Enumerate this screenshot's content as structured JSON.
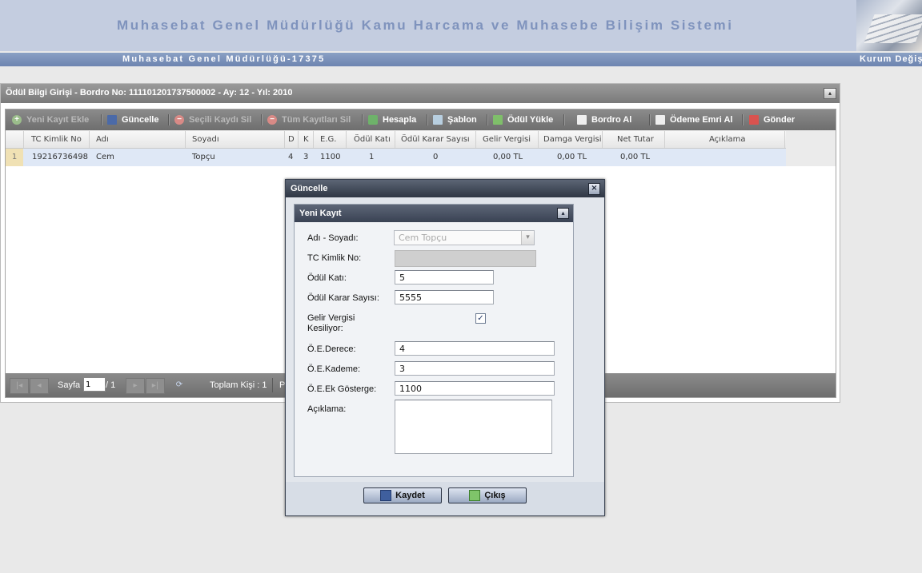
{
  "header": {
    "system_title": "Muhasebat Genel Müdürlüğü Kamu Harcama ve Muhasebe Bilişim Sistemi",
    "org_name": "Muhasebat Genel Müdürlüğü-17375",
    "kurum_link": "Kurum Değiş"
  },
  "panel": {
    "title": "Ödül Bilgi Girişi - Bordro No: 111101201737500002 - Ay: 12 - Yıl: 2010"
  },
  "toolbar": {
    "items": [
      {
        "label": "Yeni Kayıt Ekle",
        "icon": "add-icon",
        "enabled": false
      },
      {
        "label": "Güncelle",
        "icon": "save-icon",
        "enabled": true
      },
      {
        "label": "Seçili Kaydı Sil",
        "icon": "remove-icon",
        "enabled": false
      },
      {
        "label": "Tüm Kayıtları Sil",
        "icon": "remove-icon",
        "enabled": false
      },
      {
        "label": "Hesapla",
        "icon": "calculator-icon",
        "enabled": true
      },
      {
        "label": "Şablon",
        "icon": "template-icon",
        "enabled": true
      },
      {
        "label": "Ödül Yükle",
        "icon": "upload-icon",
        "enabled": true
      },
      {
        "label": "Bordro Al",
        "icon": "document-icon",
        "enabled": true
      },
      {
        "label": "Ödeme Emri Al",
        "icon": "document-icon",
        "enabled": true
      },
      {
        "label": "Gönder",
        "icon": "send-icon",
        "enabled": true
      }
    ]
  },
  "grid": {
    "columns": [
      "TC Kimlik No",
      "Adı",
      "Soyadı",
      "D",
      "K",
      "E.G.",
      "Ödül Katı",
      "Ödül Karar Sayısı",
      "Gelir Vergisi",
      "Damga Vergisi",
      "Net Tutar",
      "Açıklama"
    ],
    "rows": [
      {
        "num": "1",
        "tc": "19216736498",
        "adi": "Cem",
        "soyadi": "Topçu",
        "d": "4",
        "k": "3",
        "eg": "1100",
        "odul_kati": "1",
        "karar": "0",
        "gelir": "0,00 TL",
        "damga": "0,00 TL",
        "net": "0,00 TL",
        "aciklama": ""
      }
    ]
  },
  "paging": {
    "page_label": "Sayfa",
    "page_value": "1",
    "page_total": "/ 1",
    "total_label": "Toplam Kişi : 1",
    "truncated": "Pe"
  },
  "dialog": {
    "title": "Güncelle",
    "panel_title": "Yeni Kayıt",
    "fields": {
      "name_label": "Adı - Soyadı:",
      "name_value": "Cem Topçu",
      "tc_label": "TC Kimlik No:",
      "tc_value": "",
      "odul_kati_label": "Ödül Katı:",
      "odul_kati_value": "5",
      "karar_label": "Ödül Karar Sayısı:",
      "karar_value": "5555",
      "gv_label": "Gelir Vergisi Kesiliyor:",
      "gv_checked": true,
      "derece_label": "Ö.E.Derece:",
      "derece_value": "4",
      "kademe_label": "Ö.E.Kademe:",
      "kademe_value": "3",
      "ek_gosterge_label": "Ö.E.Ek Gösterge:",
      "ek_gosterge_value": "1100",
      "aciklama_label": "Açıklama:",
      "aciklama_value": ""
    },
    "save_label": "Kaydet",
    "exit_label": "Çıkış"
  },
  "colors": {
    "header_bg": "#c4cde0",
    "title_text": "#7f93bd",
    "subbar": "#6d84b0",
    "toolbar": "#7a7a7a",
    "selected_row": "#dfe8f6",
    "dialog_header": "#2f3744"
  }
}
